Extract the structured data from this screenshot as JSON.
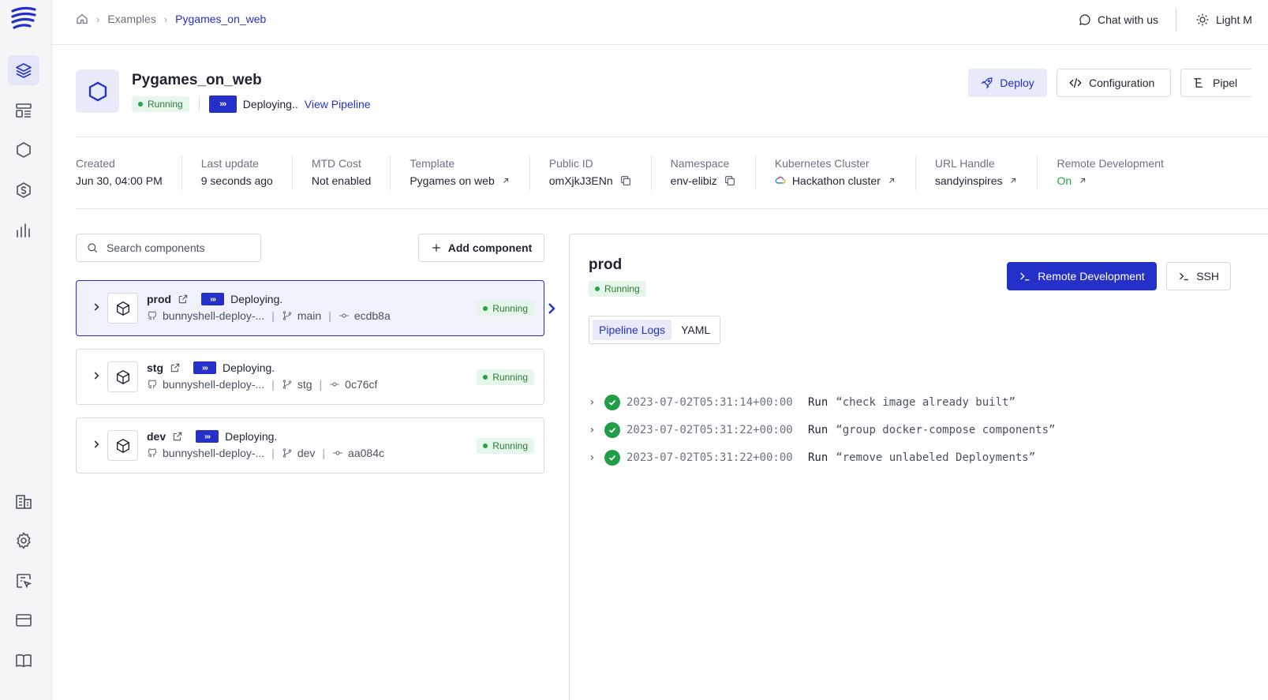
{
  "breadcrumb": {
    "items": [
      "Examples",
      "Pygames_on_web"
    ]
  },
  "topbar": {
    "chat_label": "Chat with us",
    "theme_label": "Light M"
  },
  "env": {
    "title": "Pygames_on_web",
    "status": "Running",
    "pipeline_status": "Deploying..",
    "view_pipeline": "View Pipeline"
  },
  "header_buttons": {
    "deploy": "Deploy",
    "configuration": "Configuration",
    "pipeline": "Pipel"
  },
  "info": [
    {
      "label": "Created",
      "value": "Jun 30, 04:00 PM"
    },
    {
      "label": "Last update",
      "value": "9 seconds ago"
    },
    {
      "label": "MTD Cost",
      "value": "Not enabled"
    },
    {
      "label": "Template",
      "value": "Pygames on web"
    },
    {
      "label": "Public ID",
      "value": "omXjkJ3ENn"
    },
    {
      "label": "Namespace",
      "value": "env-elibiz"
    },
    {
      "label": "Kubernetes Cluster",
      "value": "Hackathon cluster"
    },
    {
      "label": "URL Handle",
      "value": "sandyinspires"
    },
    {
      "label": "Remote Development",
      "value": "On"
    }
  ],
  "search": {
    "placeholder": "Search  components"
  },
  "add_component": "Add component",
  "components": [
    {
      "name": "prod",
      "status_text": "Deploying.",
      "repo": "bunnyshell-deploy-...",
      "branch": "main",
      "commit": "ecdb8a",
      "status": "Running"
    },
    {
      "name": "stg",
      "status_text": "Deploying.",
      "repo": "bunnyshell-deploy-...",
      "branch": "stg",
      "commit": "0c76cf",
      "status": "Running"
    },
    {
      "name": "dev",
      "status_text": "Deploying.",
      "repo": "bunnyshell-deploy-...",
      "branch": "dev",
      "commit": "aa084c",
      "status": "Running"
    }
  ],
  "detail": {
    "title": "prod",
    "status": "Running",
    "remote_dev_button": "Remote Development",
    "ssh_button": "SSH",
    "tabs": [
      "Pipeline Logs",
      "YAML"
    ],
    "logs": [
      {
        "timestamp": "2023-07-02T05:31:14+00:00",
        "verb": "Run",
        "command": "“check image already built”"
      },
      {
        "timestamp": "2023-07-02T05:31:22+00:00",
        "verb": "Run",
        "command": "“group docker-compose components”"
      },
      {
        "timestamp": "2023-07-02T05:31:22+00:00",
        "verb": "Run",
        "command": "“remove unlabeled Deployments”"
      }
    ]
  },
  "colors": {
    "accent": "#2530c9",
    "success": "#22a447",
    "sidebar_bg": "#f4f5f7"
  }
}
